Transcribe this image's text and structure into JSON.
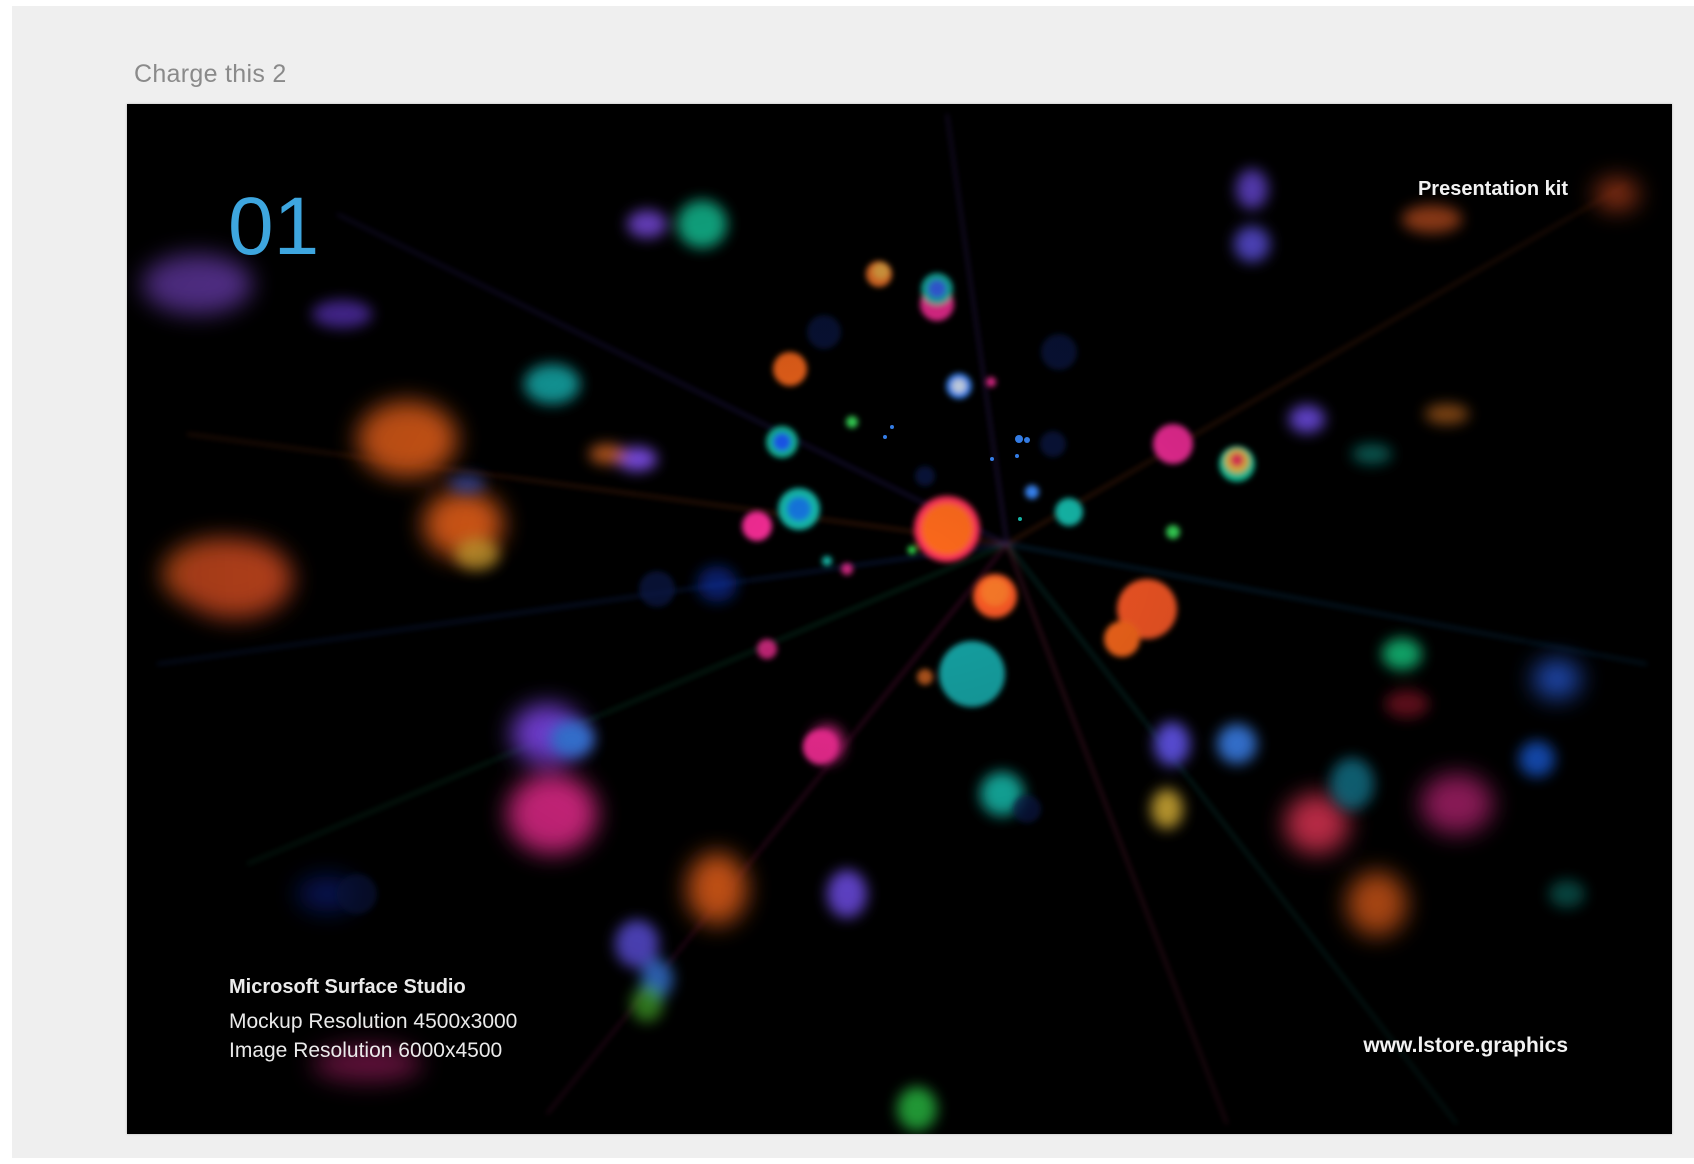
{
  "artboard": {
    "label": "Charge this 2"
  },
  "slide": {
    "number": "01",
    "kit_label": "Presentation kit",
    "spec_title": "Microsoft Surface Studio",
    "spec_mockup": "Mockup Resolution 4500x3000",
    "spec_image": "Image Resolution 6000x4500",
    "site": "www.lstore.graphics"
  },
  "colors": {
    "canvas_background": "#efefef",
    "slide_background": "#000000",
    "slide_number": "#3ea6df",
    "slide_text": "#f2f2f2"
  }
}
